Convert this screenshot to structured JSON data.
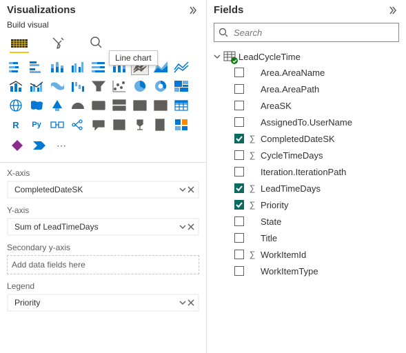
{
  "viz": {
    "title": "Visualizations",
    "subtitle": "Build visual",
    "tooltip": "Line chart",
    "sections": {
      "xaxis": {
        "label": "X-axis",
        "pill": "CompletedDateSK"
      },
      "yaxis": {
        "label": "Y-axis",
        "pill": "Sum of LeadTimeDays"
      },
      "secy": {
        "label": "Secondary y-axis",
        "placeholder": "Add data fields here"
      },
      "legend": {
        "label": "Legend",
        "pill": "Priority"
      }
    }
  },
  "fields": {
    "title": "Fields",
    "search_placeholder": "Search",
    "table": "LeadCycleTime",
    "items": [
      {
        "name": "Area.AreaName",
        "checked": false,
        "sigma": false
      },
      {
        "name": "Area.AreaPath",
        "checked": false,
        "sigma": false
      },
      {
        "name": "AreaSK",
        "checked": false,
        "sigma": false
      },
      {
        "name": "AssignedTo.UserName",
        "checked": false,
        "sigma": false
      },
      {
        "name": "CompletedDateSK",
        "checked": true,
        "sigma": true
      },
      {
        "name": "CycleTimeDays",
        "checked": false,
        "sigma": true
      },
      {
        "name": "Iteration.IterationPath",
        "checked": false,
        "sigma": false
      },
      {
        "name": "LeadTimeDays",
        "checked": true,
        "sigma": true
      },
      {
        "name": "Priority",
        "checked": true,
        "sigma": true
      },
      {
        "name": "State",
        "checked": false,
        "sigma": false
      },
      {
        "name": "Title",
        "checked": false,
        "sigma": false
      },
      {
        "name": "WorkItemId",
        "checked": false,
        "sigma": true
      },
      {
        "name": "WorkItemType",
        "checked": false,
        "sigma": false
      }
    ]
  }
}
